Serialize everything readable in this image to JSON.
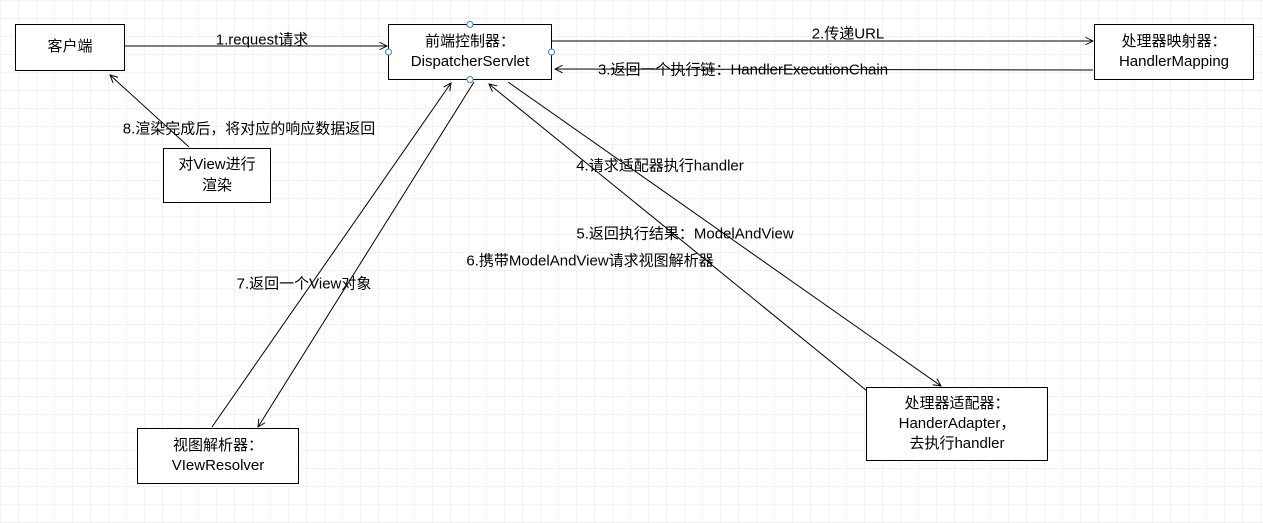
{
  "nodes": {
    "client": {
      "line1": "客户端"
    },
    "dispatcher": {
      "line1": "前端控制器：",
      "line2": "DispatcherServlet"
    },
    "mapping": {
      "line1": "处理器映射器：",
      "line2": "HandlerMapping"
    },
    "adapter": {
      "line1": "处理器适配器：",
      "line2": "HanderAdapter，",
      "line3": "去执行handler"
    },
    "resolver": {
      "line1": "视图解析器：",
      "line2": "VIewResolver"
    },
    "render": {
      "line1": "对View进行",
      "line2": "渲染"
    }
  },
  "labels": {
    "l1": "1.request请求",
    "l2": "2.传递URL",
    "l3": "3.返回一个执行链：HandlerExecutionChain",
    "l4": "4.请求适配器执行handler",
    "l5": "5.返回执行结果：ModelAndView",
    "l6": "6.携带ModelAndView请求视图解析器",
    "l7": "7.返回一个View对象",
    "l8": "8.渲染完成后，将对应的响应数据返回"
  }
}
